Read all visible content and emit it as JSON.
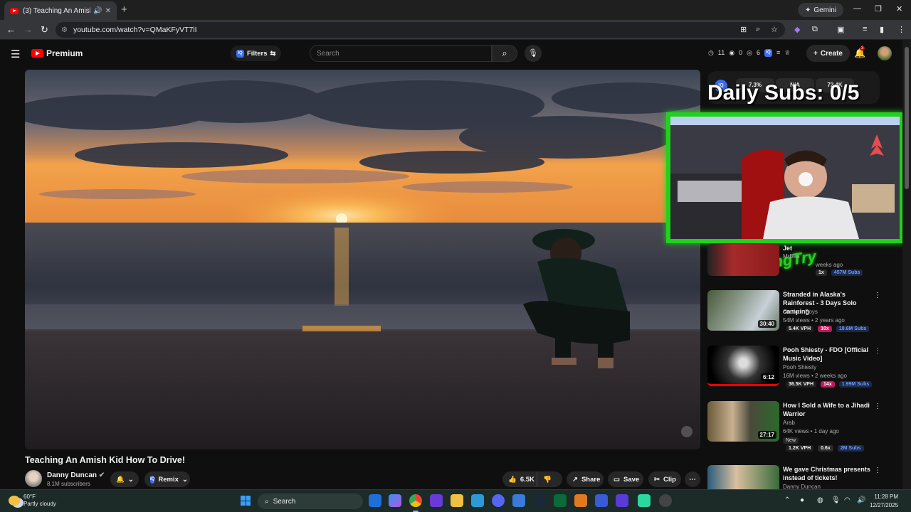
{
  "browser": {
    "tab_title": "(3) Teaching An Amish Kid",
    "new_tab": "+",
    "gemini_label": "Gemini",
    "url": "youtube.com/watch?v=QMaKFyVT7lI"
  },
  "header": {
    "logo_text": "Premium",
    "filters_label": "Filters",
    "search_placeholder": "Search",
    "stat_a": "11",
    "stat_b": "0",
    "stat_c": "6",
    "create_label": "Create",
    "notif_count": "3"
  },
  "overlay": {
    "iq_label": "IQ",
    "pill_1": "7.3%",
    "pill_2": "N/A",
    "pill_3": "72.4K",
    "daily_subs": "Daily Subs: 0/5",
    "streamer_logo": "KellingTry"
  },
  "video": {
    "title": "Teaching An Amish Kid How To Drive!",
    "channel": "Danny Duncan",
    "subscribers": "8.1M subscribers",
    "remix_label": "Remix",
    "likes": "6.5K",
    "share_label": "Share",
    "save_label": "Save",
    "clip_label": "Clip"
  },
  "recommendations": [
    {
      "title": "Jet",
      "channel": "MrBea",
      "meta": "weeks ago",
      "vph": "",
      "mult": "1x",
      "subs": "457M Subs"
    },
    {
      "title": "Stranded in Alaska's Rainforest - 3 Days Solo camping",
      "channel": "Outdoor Boys",
      "meta": "54M views • 2 years ago",
      "duration": "30:40",
      "vph": "5.4K VPH",
      "mult": "10x",
      "subs": "18.6M Subs"
    },
    {
      "title": "Pooh Shiesty - FDO [Official Music Video]",
      "channel": "Pooh Shiesty",
      "meta": "16M views • 2 weeks ago",
      "duration": "6:12",
      "vph": "36.5K VPH",
      "mult": "14x",
      "subs": "1.99M Subs"
    },
    {
      "title": "How I Sold a Wife to a Jihadi Warrior",
      "channel": "Arab",
      "meta": "64K views • 1 day ago",
      "badge": "New",
      "duration": "27:17",
      "vph": "1.2K VPH",
      "mult": "0.6x",
      "subs": "2M Subs"
    },
    {
      "title": "We gave Christmas presents instead of tickets!",
      "channel": "Danny Duncan",
      "meta": ""
    }
  ],
  "taskbar": {
    "temperature": "60°F",
    "condition": "Partly cloudy",
    "search_label": "Search",
    "time": "11:28 PM",
    "date": "12/27/2025"
  }
}
